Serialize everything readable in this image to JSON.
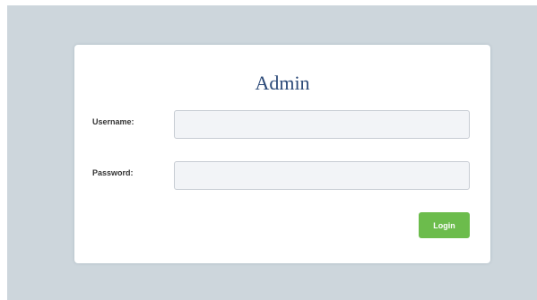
{
  "login_form": {
    "title": "Admin",
    "username": {
      "label": "Username:",
      "value": "",
      "placeholder": ""
    },
    "password": {
      "label": "Password:",
      "value": "",
      "placeholder": ""
    },
    "submit_label": "Login"
  },
  "colors": {
    "background": "#cdd6dc",
    "card": "#ffffff",
    "title": "#2c4a78",
    "field_background": "#f2f4f7",
    "field_border": "#c7ccd3",
    "login_button": "#6cbc4c"
  }
}
